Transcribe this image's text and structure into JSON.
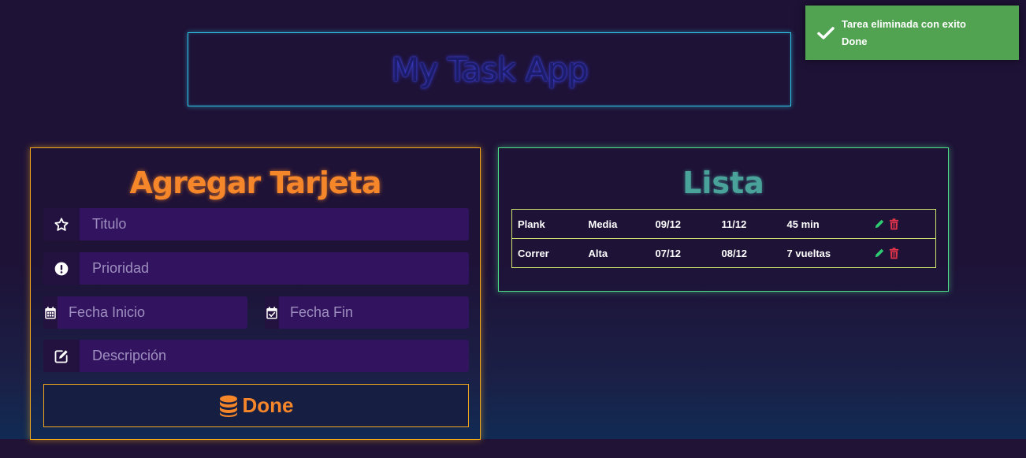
{
  "header": {
    "title": "My Task App"
  },
  "toast": {
    "message": "Tarea eliminada con exito",
    "subtitle": "Done",
    "color": "#51a351"
  },
  "form": {
    "title": "Agregar Tarjeta",
    "fields": {
      "titulo": {
        "placeholder": "Titulo",
        "icon": "star-icon"
      },
      "prioridad": {
        "placeholder": "Prioridad",
        "icon": "exclamation-circle-icon"
      },
      "fecha_inicio": {
        "placeholder": "Fecha Inicio",
        "icon": "calendar-icon"
      },
      "fecha_fin": {
        "placeholder": "Fecha Fin",
        "icon": "calendar-check-icon"
      },
      "descripcion": {
        "placeholder": "Descripción",
        "icon": "edit-icon"
      }
    },
    "submit_label": "Done",
    "submit_icon": "database-icon",
    "accent": "#f6862a"
  },
  "list": {
    "title": "Lista",
    "accent": "#4fe08a",
    "tasks": [
      {
        "titulo": "Plank",
        "prioridad": "Media",
        "inicio": "09/12",
        "fin": "11/12",
        "descripcion": "45 min"
      },
      {
        "titulo": "Correr",
        "prioridad": "Alta",
        "inicio": "07/12",
        "fin": "08/12",
        "descripcion": "7 vueltas"
      }
    ],
    "action_icons": [
      "pencil-icon",
      "trash-icon"
    ],
    "edit_color": "#2ecc71",
    "delete_color": "#e0344a"
  }
}
